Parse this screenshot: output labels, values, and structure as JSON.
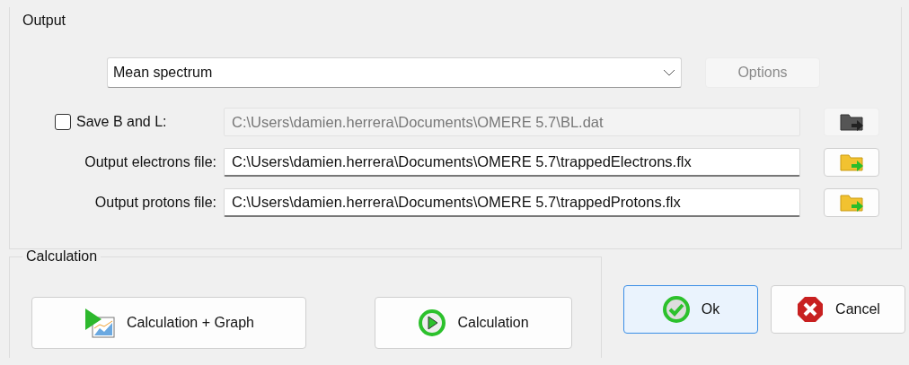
{
  "output": {
    "title": "Output",
    "spectrum": {
      "value": "Mean spectrum"
    },
    "options_button": {
      "label": "Options",
      "disabled": true
    },
    "files": [
      {
        "kind": "checkbox",
        "label": "Save B and L:",
        "checked": false,
        "value": "C:\\Users\\damien.herrera\\Documents\\OMERE 5.7\\BL.dat",
        "disabled": true
      },
      {
        "kind": "label",
        "label": "Output electrons file:",
        "value": "C:\\Users\\damien.herrera\\Documents\\OMERE 5.7\\trappedElectrons.flx",
        "disabled": false
      },
      {
        "kind": "label",
        "label": "Output protons file:",
        "value": "C:\\Users\\damien.herrera\\Documents\\OMERE 5.7\\trappedProtons.flx",
        "disabled": false
      }
    ]
  },
  "calculation": {
    "title": "Calculation",
    "buttons": [
      {
        "kind": "graph",
        "label": "Calculation + Graph"
      },
      {
        "kind": "play",
        "label": "Calculation"
      }
    ]
  },
  "dialog_buttons": [
    {
      "kind": "ok",
      "label": "Ok",
      "default": true
    },
    {
      "kind": "cancel",
      "label": "Cancel",
      "default": false
    }
  ]
}
